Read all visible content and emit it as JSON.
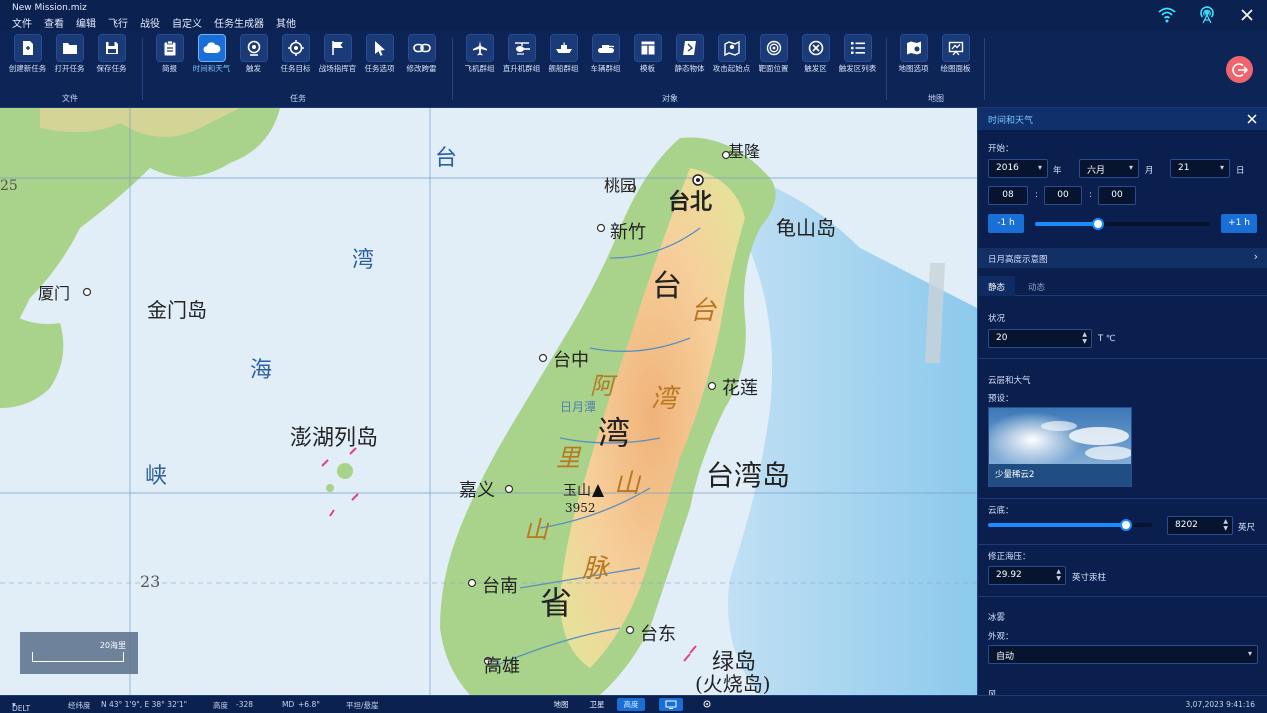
{
  "app": {
    "title": "New Mission.miz",
    "menu": [
      "文件",
      "查看",
      "编辑",
      "飞行",
      "战役",
      "自定义",
      "任务生成器",
      "其他"
    ]
  },
  "topbar_icons": [
    "wifi-icon",
    "network-signal-icon",
    "close-icon"
  ],
  "ribbon": {
    "groups": [
      {
        "label": "文件",
        "buttons": [
          {
            "label": "创建新任务",
            "icon": "new-file-icon"
          },
          {
            "label": "打开任务",
            "icon": "folder-icon"
          },
          {
            "label": "保存任务",
            "icon": "save-icon"
          }
        ]
      },
      {
        "label": "任务",
        "buttons": [
          {
            "label": "简报",
            "icon": "clipboard-icon"
          },
          {
            "label": "时间和天气",
            "icon": "cloud-icon",
            "active": true
          },
          {
            "label": "触发",
            "icon": "trigger-icon"
          },
          {
            "label": "任务目标",
            "icon": "target-icon"
          },
          {
            "label": "战场指挥官",
            "icon": "flag-icon"
          },
          {
            "label": "任务选项",
            "icon": "cursor-icon"
          },
          {
            "label": "修改跨雷",
            "icon": "link-icon"
          }
        ]
      },
      {
        "label": "对象",
        "buttons": [
          {
            "label": "飞机群组",
            "icon": "airplane-icon"
          },
          {
            "label": "直升机群组",
            "icon": "helicopter-icon"
          },
          {
            "label": "舰船群组",
            "icon": "ship-icon"
          },
          {
            "label": "车辆群组",
            "icon": "tank-icon"
          },
          {
            "label": "模板",
            "icon": "template-icon"
          },
          {
            "label": "静态物体",
            "icon": "static-object-icon"
          },
          {
            "label": "攻击起始点",
            "icon": "attack-start-icon"
          },
          {
            "label": "靶面位置",
            "icon": "bullseye-icon"
          },
          {
            "label": "触发区",
            "icon": "trigger-zone-icon"
          },
          {
            "label": "触发区列表",
            "icon": "list-icon"
          }
        ]
      },
      {
        "label": "地图",
        "buttons": [
          {
            "label": "地图选项",
            "icon": "map-options-icon"
          },
          {
            "label": "绘图面板",
            "icon": "draw-panel-icon"
          }
        ]
      }
    ]
  },
  "map": {
    "labels": {
      "tai_strait_1": "台",
      "tai_strait_2": "湾",
      "tai_strait_3": "海",
      "tai_strait_4": "峡",
      "xiamen": "厦门",
      "jinmen": "金门岛",
      "penghu": "澎湖列岛",
      "jilong": "基隆",
      "taoyuan": "桃园",
      "taibei": "台北",
      "xinzhu": "新竹",
      "guishan": "龟山岛",
      "taizhong": "台中",
      "hualian": "花莲",
      "jiayi": "嘉义",
      "yushan": "玉山",
      "yushan_height": "3952",
      "tainan": "台南",
      "taidong": "台东",
      "gaoxiong": "高雄",
      "taiwan_island": "台湾岛",
      "ludao": "绿岛",
      "huoshao": "(火烧岛)",
      "sun_moon_lake": "日月潭",
      "prov_1": "台",
      "prov_2": "湾",
      "prov_3": "省",
      "mtn_1": "台",
      "mtn_2": "湾",
      "mtn_3": "山",
      "mtn_4": "脉",
      "ali_1": "阿",
      "ali_2": "里",
      "ali_3": "山",
      "lat_25": "25",
      "lat_23": "23"
    },
    "scale_label": "20海里"
  },
  "panel": {
    "title": "时间和天气",
    "start_label": "开始：",
    "year": "2016",
    "year_unit": "年",
    "month": "六月",
    "month_unit": "月",
    "day": "21",
    "day_unit": "日",
    "hour": "08",
    "minute": "00",
    "second": "00",
    "minus_hour": "-1 h",
    "plus_hour": "+1 h",
    "time_slider_fraction": 0.36,
    "sun_moon_chart": "日月高度示意图",
    "tabs": [
      "静态",
      "动态"
    ],
    "active_tab": "静态",
    "conditions_label": "状况",
    "temperature": "20",
    "temperature_unit": "T ℃",
    "clouds_section": "云层和大气",
    "preset_label": "预设：",
    "preset_name": "少量稀云2",
    "cloud_base_label": "云底：",
    "cloud_base": "8202",
    "cloud_base_unit": "英尺",
    "cloud_base_fraction": 0.84,
    "qnh_label": "修正海压：",
    "qnh": "29.92",
    "qnh_unit": "英寸汞柱",
    "ice_section": "冰雾",
    "appearance_label": "外观：",
    "appearance": "自动",
    "wind_section": "风"
  },
  "statusbar": {
    "mode": "DELT",
    "coords_label": "经纬度",
    "coords": "N 43° 1'9\", E 38° 32'1\"",
    "elevation_label": "高度",
    "elevation": "-328",
    "md_label": "MD",
    "md": "+6.8°",
    "terrain": "平坦/悬崖",
    "map_buttons": [
      "地图",
      "卫星",
      "高度"
    ],
    "active_map_button": "高度",
    "datetime": "3,07,2023 9:41:16"
  },
  "colors": {
    "background": "#0b2150",
    "accent": "#1a6fd6",
    "exit_button": "#f06470",
    "sea": "#dbe9f4",
    "land_lowland": "#a9d28a",
    "land_highland": "#f3c48f"
  }
}
